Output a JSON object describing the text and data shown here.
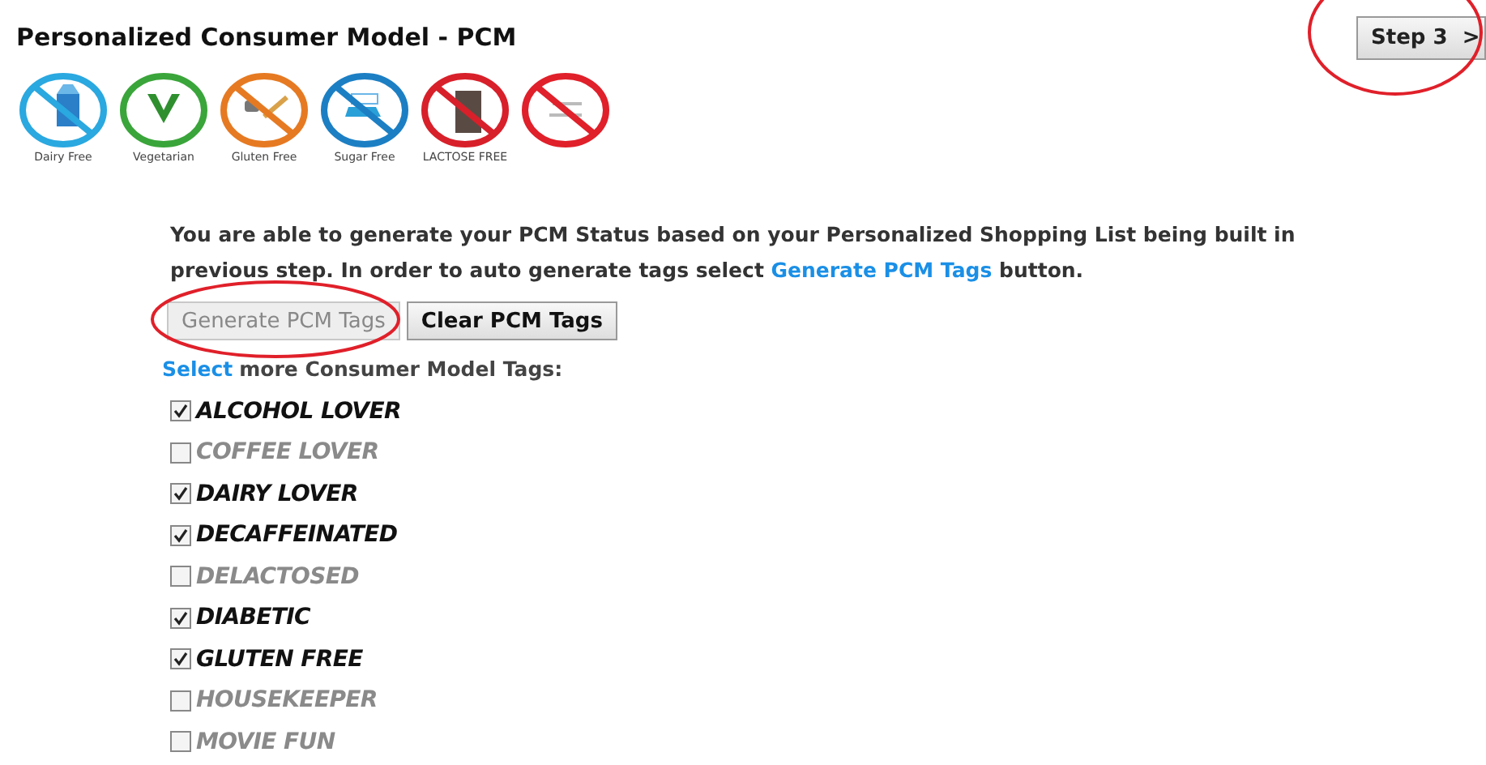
{
  "title": "Personalized Consumer Model - PCM",
  "step_button": {
    "label": "Step 3",
    "arrow": ">"
  },
  "badges": [
    {
      "kind": "dairy",
      "label": "Dairy Free"
    },
    {
      "kind": "vegetarian",
      "label": "Vegetarian"
    },
    {
      "kind": "gluten",
      "label": "Gluten Free"
    },
    {
      "kind": "sugar",
      "label": "Sugar Free"
    },
    {
      "kind": "lactose",
      "label": "LACTOSE FREE"
    },
    {
      "kind": "stamp"
    }
  ],
  "intro": "You are able to generate your PCM Status based on your Personalized Shopping List being built in previous step. In order to auto generate tags select ",
  "intro_link": "Generate PCM Tags",
  "intro_end": " button.",
  "buttons": [
    {
      "label": "Generate PCM Tags",
      "disabled": true
    },
    {
      "label": "Clear PCM Tags",
      "disabled": false
    }
  ],
  "select_link": "Select",
  "select_text": "more Consumer Model Tags:",
  "tags": [
    {
      "label": "ALCOHOL LOVER",
      "checked": true
    },
    {
      "label": "COFFEE LOVER",
      "checked": false
    },
    {
      "label": "DAIRY LOVER",
      "checked": true
    },
    {
      "label": "DECAFFEINATED",
      "checked": true
    },
    {
      "label": "DELACTOSED",
      "checked": false
    },
    {
      "label": "DIABETIC",
      "checked": true
    },
    {
      "label": "GLUTEN FREE",
      "checked": true
    },
    {
      "label": "HOUSEKEEPER",
      "checked": false
    },
    {
      "label": "MOVIE FUN",
      "checked": false
    }
  ]
}
